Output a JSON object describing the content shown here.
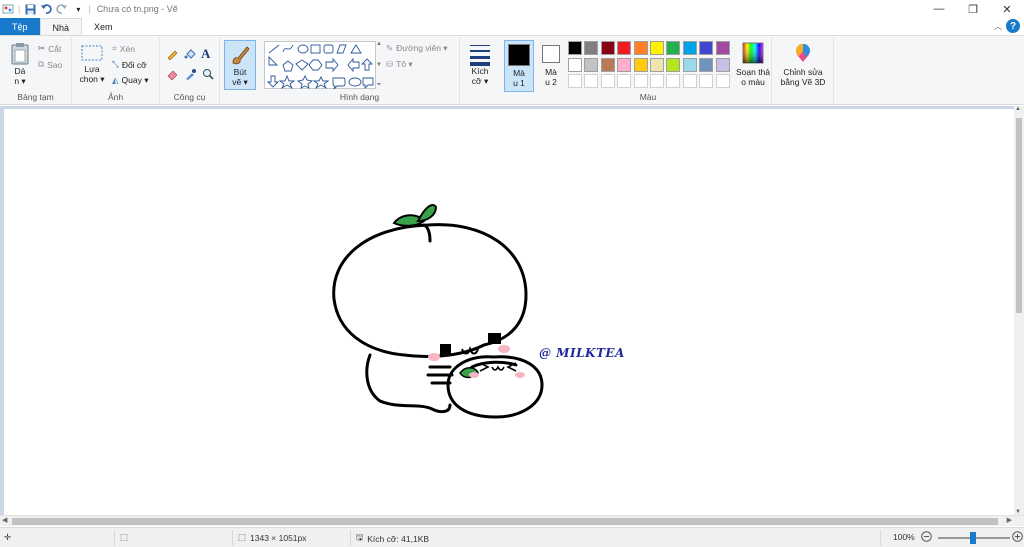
{
  "window": {
    "title": "Chưa có tn.png - Vẽ"
  },
  "tabs": [
    {
      "label": "Tệp"
    },
    {
      "label": "Nhà"
    },
    {
      "label": "Xem"
    }
  ],
  "ribbon": {
    "clipboard": {
      "label": "Bảng tạm",
      "paste": "Dá\nn ▾",
      "cut": "Cắt",
      "copy": "Sao"
    },
    "image": {
      "label": "Ảnh",
      "select": "Lựa\nchọn ▾",
      "crop": "Xén",
      "resize": "Đổi cỡ",
      "rotate": "Quay ▾"
    },
    "tools": {
      "label": "Công cụ"
    },
    "brushes": {
      "label": "Bút\nvẽ ▾"
    },
    "shapes": {
      "label": "Hình dạng",
      "outline": "Đường viên ▾",
      "fill": "Tô ▾"
    },
    "size": {
      "label": "Kích\ncỡ ▾"
    },
    "color1": {
      "label": "Mà\nu 1",
      "value": "#000000"
    },
    "color2": {
      "label": "Mà\nu 2",
      "value": "#ffffff"
    },
    "colors": {
      "label": "Màu",
      "palette_row1": [
        "#000000",
        "#7f7f7f",
        "#880015",
        "#ed1c24",
        "#ff7f27",
        "#fff200",
        "#22b14c",
        "#00a2e8",
        "#3f48cc",
        "#a349a4"
      ],
      "palette_row2": [
        "#ffffff",
        "#c3c3c3",
        "#b97a57",
        "#ffaec9",
        "#ffc90e",
        "#efe4b0",
        "#b5e61d",
        "#99d9ea",
        "#7092be",
        "#c8bfe7"
      ]
    },
    "edit_colors": {
      "label": "Soạn thả\no màu"
    },
    "paint3d": {
      "label": "Chỉnh sửa\nbằng Vẽ 3D"
    }
  },
  "canvas": {
    "watermark": "@ MILKTEA"
  },
  "status": {
    "dimensions": "1343 × 1051px",
    "filesize": "Kích cỡ: 41,1KB",
    "zoom": "100%"
  },
  "colors": {
    "accent": "#1979ca",
    "selected_tool": "#cce4f7",
    "canvas_bg": "#cad5e6",
    "leaf": "#3aa34a",
    "blush": "#f7b6c2",
    "text_blue": "#1f2a9c"
  }
}
